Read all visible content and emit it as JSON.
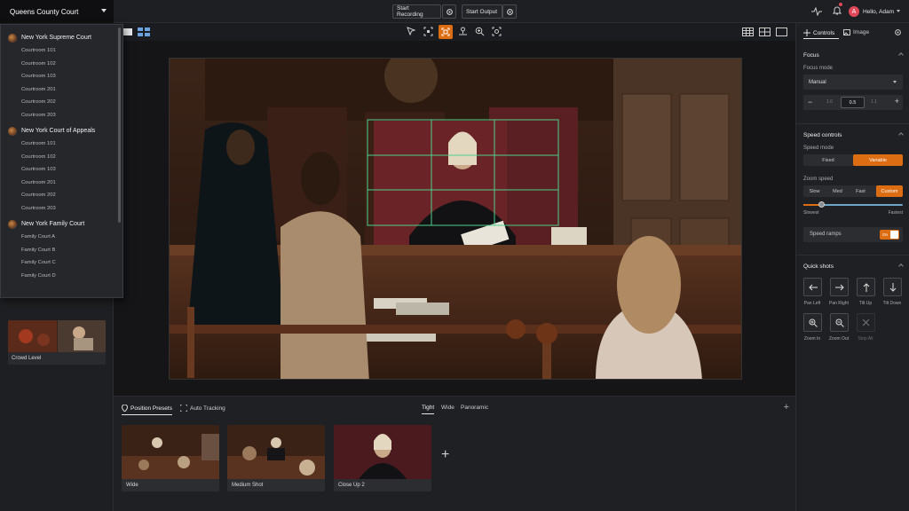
{
  "header": {
    "court": "Queens County Court",
    "start_recording": "Start Recording",
    "start_output": "Start Output",
    "avatar_letter": "A",
    "greeting": "Hello, Adam"
  },
  "dropdown": {
    "groups": [
      {
        "name": "New York Supreme Court",
        "items": [
          "Courtroom 101",
          "Courtroom 102",
          "Courtroom 103",
          "Courtroom 201",
          "Courtroom 202",
          "Courtroom 203"
        ]
      },
      {
        "name": "New York Court of Appeals",
        "items": [
          "Courtroom 101",
          "Courtroom 102",
          "Courtroom 103",
          "Courtroom 201",
          "Courtroom 202",
          "Courtroom 203"
        ]
      },
      {
        "name": "New York Family Court",
        "items": [
          "Family Court A",
          "Family Court B",
          "Family Court C",
          "Family Court D"
        ]
      }
    ]
  },
  "left": {
    "crowd_label": "Crowd Level"
  },
  "bottom": {
    "tab_position_presets": "Position Presets",
    "tab_auto_tracking": "Auto Tracking",
    "filter_tight": "Tight",
    "filter_wide": "Wide",
    "filter_panoramic": "Panoramic",
    "presets": [
      "Wide",
      "Medium Shot",
      "Close Up 2"
    ]
  },
  "right": {
    "tab_controls": "Controls",
    "tab_image": "Image",
    "focus": {
      "title": "Focus",
      "mode_label": "Focus mode",
      "mode_value": "Manual",
      "left_val": "1.0",
      "center_val": "0.5",
      "right_val": "1.1"
    },
    "speed": {
      "title": "Speed controls",
      "mode_label": "Speed mode",
      "fixed": "Fixed",
      "variable": "Variable",
      "zoom_label": "Zoom speed",
      "slow": "Slow",
      "med": "Med",
      "fast": "Fast",
      "custom": "Custom",
      "slider_min": "Slowest",
      "slider_max": "Fastest",
      "slider_value": 0.18,
      "ramps": "Speed ramps",
      "ramps_state": "On"
    },
    "quick": {
      "title": "Quick shots",
      "pan_left": "Pan Left",
      "pan_right": "Pan Right",
      "tilt_up": "Tilt Up",
      "tilt_down": "Tilt Down",
      "zoom_in": "Zoom In",
      "zoom_out": "Zoom Out",
      "stop_all": "Stop All"
    }
  },
  "colors": {
    "accent": "#dd6d12",
    "frame_guide": "#4ed18a"
  }
}
